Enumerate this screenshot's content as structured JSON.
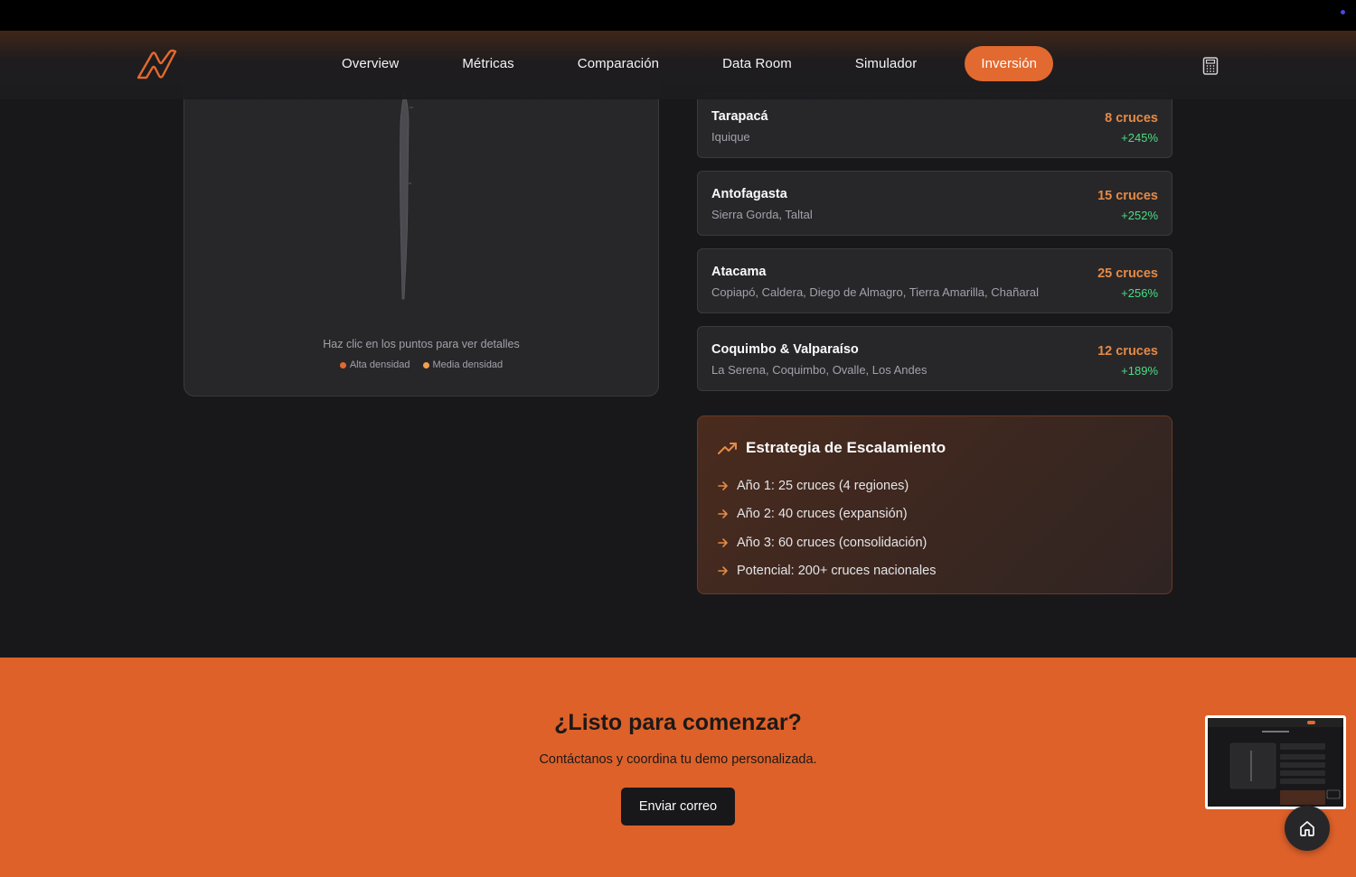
{
  "nav": {
    "links": [
      "Overview",
      "Métricas",
      "Comparación",
      "Data Room",
      "Simulador"
    ],
    "active": "Inversión",
    "logo_icon": "brand-logo",
    "calculator_icon": "calculator-icon"
  },
  "map": {
    "hint": "Haz clic en los puntos para ver detalles",
    "legend": [
      {
        "label": "Alta densidad",
        "color": "#e2692f"
      },
      {
        "label": "Media densidad",
        "color": "#f0a050"
      }
    ]
  },
  "regions": [
    {
      "name": "Tarapacá",
      "cities": "Iquique",
      "crosses": "8 cruces",
      "growth": "+245%"
    },
    {
      "name": "Antofagasta",
      "cities": "Sierra Gorda, Taltal",
      "crosses": "15 cruces",
      "growth": "+252%"
    },
    {
      "name": "Atacama",
      "cities": "Copiapó, Caldera, Diego de Almagro, Tierra Amarilla, Chañaral",
      "crosses": "25 cruces",
      "growth": "+256%"
    },
    {
      "name": "Coquimbo & Valparaíso",
      "cities": "La Serena, Coquimbo, Ovalle, Los Andes",
      "crosses": "12 cruces",
      "growth": "+189%"
    }
  ],
  "strategy": {
    "title": "Estrategia de Escalamiento",
    "items": [
      "Año 1: 25 cruces (4 regiones)",
      "Año 2: 40 cruces (expansión)",
      "Año 3: 60 cruces (consolidación)",
      "Potencial: 200+ cruces nacionales"
    ]
  },
  "cta": {
    "title": "¿Listo para comenzar?",
    "subtitle": "Contáctanos y coordina tu demo personalizada.",
    "button": "Enviar correo"
  },
  "colors": {
    "accent": "#e2692f",
    "growth": "#4ade80",
    "background": "#18181b",
    "card": "#27272a"
  }
}
